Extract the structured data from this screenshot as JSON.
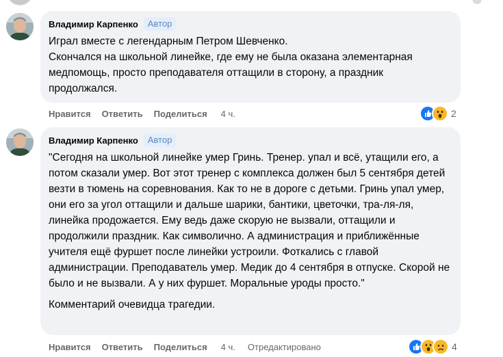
{
  "comments": [
    {
      "author": "Владимир Карпенко",
      "badge": "Автор",
      "paragraphs": [
        "Играл вместе с легендарным Петром Шевченко.",
        "Скончался на школьной линейке, где ему не была оказана элементарная медпомощь, просто преподавателя оттащили в сторону, а праздник продолжался."
      ],
      "actions": {
        "like": "Нравится",
        "reply": "Ответить",
        "share": "Поделиться",
        "time": "4 ч."
      },
      "reactions": {
        "icons": [
          "like-icon",
          "wow-icon"
        ],
        "count": "2"
      }
    },
    {
      "author": "Владимир Карпенко",
      "badge": "Автор",
      "paragraphs": [
        "\"Сегодня на школьной линейке умер Гринь. Тренер. упал и всё, утащили его, а потом сказали умер. Вот этот тренер с комплекса должен был 5 сентября детей везти в тюмень на соревнования. Как то не в дороге с детьми. Гринь упал умер, они его за угол оттащили и дальше шарики, бантики, цветочки, тра-ля-ля, линейка продожается. Ему ведь даже скорую не вызвали, оттащили и продолжили праздник. Как символично. А администрация и приближённые учителя ещё фуршет после линейки устроили. Фоткались с главой администрации. Преподаватель умер. Медик до 4 сентября в отпуске. Скорой не было и не вызвали. А у них фуршет. Моральные уроды просто.\"",
        "Комментарий очевидца трагедии."
      ],
      "actions": {
        "like": "Нравится",
        "reply": "Ответить",
        "share": "Поделиться",
        "time": "4 ч.",
        "edited": "Отредактировано"
      },
      "reactions": {
        "icons": [
          "like-icon",
          "wow-icon",
          "sad-icon"
        ],
        "count": "4"
      }
    }
  ],
  "colors": {
    "bubble_bg": "#f0f2f5",
    "badge_bg": "#e4eefb",
    "badge_text": "#5f86bd",
    "meta_text": "#65676b",
    "like_blue": "#1877f2",
    "emoji_yellow": "#f7b928"
  }
}
